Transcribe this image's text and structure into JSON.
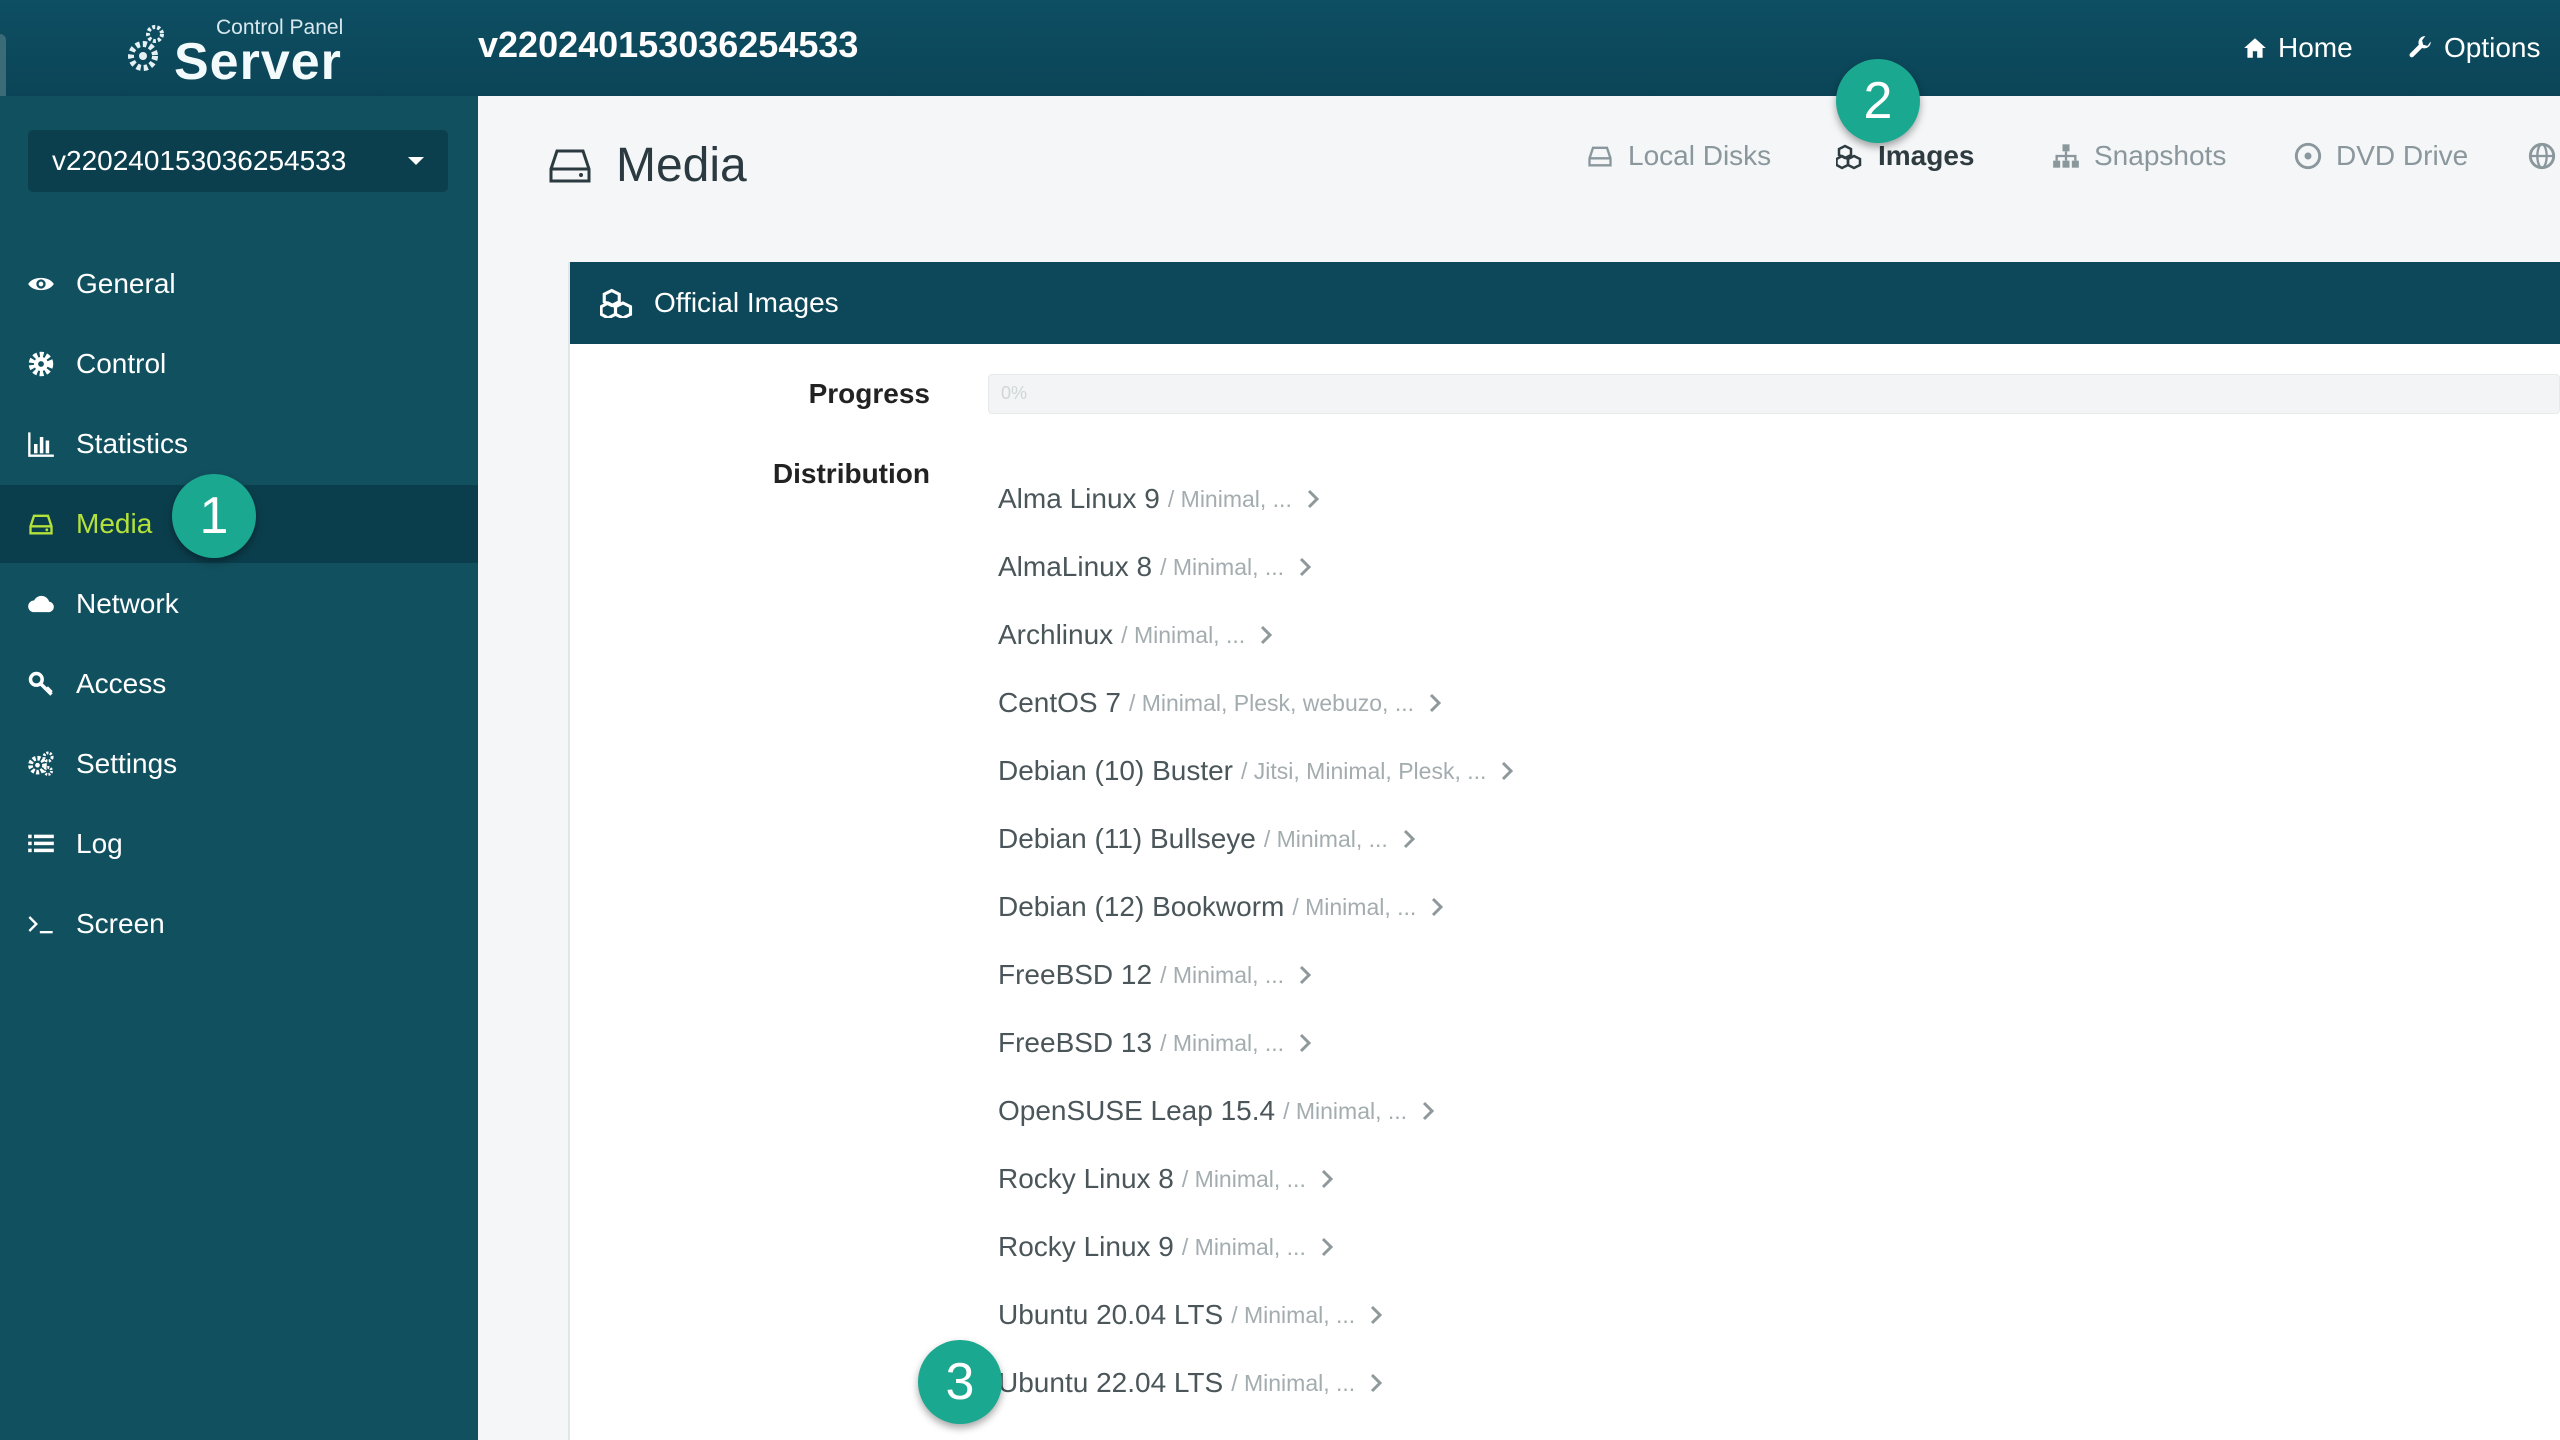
{
  "topbar": {
    "logo_small": "Control Panel",
    "logo_big": "Server",
    "server_id": "v220240153036254533",
    "nav": [
      {
        "label": "Home",
        "icon": "home-icon"
      },
      {
        "label": "Options",
        "icon": "wrench-icon"
      }
    ]
  },
  "sidebar": {
    "server_select": "v220240153036254533",
    "items": [
      {
        "label": "General",
        "icon": "eye-icon"
      },
      {
        "label": "Control",
        "icon": "gear-icon"
      },
      {
        "label": "Statistics",
        "icon": "bar-chart-icon"
      },
      {
        "label": "Media",
        "icon": "hard-drive-icon",
        "active": true
      },
      {
        "label": "Network",
        "icon": "cloud-icon"
      },
      {
        "label": "Access",
        "icon": "key-icon"
      },
      {
        "label": "Settings",
        "icon": "cogs-icon"
      },
      {
        "label": "Log",
        "icon": "list-icon"
      },
      {
        "label": "Screen",
        "icon": "terminal-icon"
      }
    ]
  },
  "main": {
    "title": "Media",
    "tabs": [
      {
        "label": "Local Disks",
        "icon": "hard-drive-icon"
      },
      {
        "label": "Images",
        "icon": "cubes-icon",
        "active": true
      },
      {
        "label": "Snapshots",
        "icon": "sitemap-icon"
      },
      {
        "label": "DVD Drive",
        "icon": "disc-icon"
      }
    ],
    "panel": {
      "title": "Official Images",
      "progress_label": "Progress",
      "progress_text": "0%",
      "distribution_label": "Distribution",
      "distributions": [
        {
          "name": "Alma Linux 9",
          "sub": "/ Minimal, ..."
        },
        {
          "name": "AlmaLinux 8",
          "sub": "/ Minimal, ..."
        },
        {
          "name": "Archlinux",
          "sub": "/ Minimal, ..."
        },
        {
          "name": "CentOS 7",
          "sub": "/ Minimal, Plesk, webuzo, ..."
        },
        {
          "name": "Debian (10) Buster",
          "sub": "/ Jitsi, Minimal, Plesk, ..."
        },
        {
          "name": "Debian (11) Bullseye",
          "sub": "/ Minimal, ..."
        },
        {
          "name": "Debian (12) Bookworm",
          "sub": "/ Minimal, ..."
        },
        {
          "name": "FreeBSD 12",
          "sub": "/ Minimal, ..."
        },
        {
          "name": "FreeBSD 13",
          "sub": "/ Minimal, ..."
        },
        {
          "name": "OpenSUSE Leap 15.4",
          "sub": "/ Minimal, ..."
        },
        {
          "name": "Rocky Linux 8",
          "sub": "/ Minimal, ..."
        },
        {
          "name": "Rocky Linux 9",
          "sub": "/ Minimal, ..."
        },
        {
          "name": "Ubuntu 20.04 LTS",
          "sub": "/ Minimal, ..."
        },
        {
          "name": "Ubuntu 22.04 LTS",
          "sub": "/ Minimal, ..."
        }
      ]
    }
  },
  "badges": [
    "1",
    "2",
    "3"
  ],
  "colors": {
    "accent": "#b4e23a",
    "sidebar": "#11505f",
    "header": "#0c4859",
    "badge": "#1aa890"
  }
}
